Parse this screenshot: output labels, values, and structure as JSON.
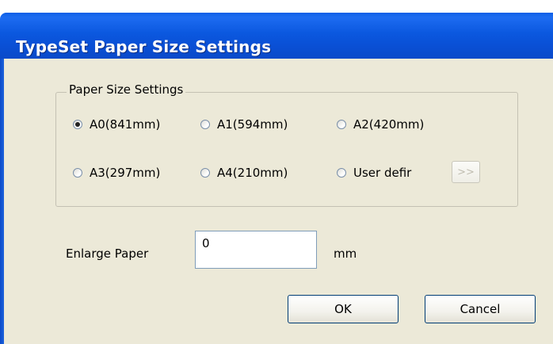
{
  "window": {
    "title": "TypeSet Paper Size Settings"
  },
  "paper_size": {
    "group_label": "Paper Size Settings",
    "options": [
      {
        "label": "A0(841mm)",
        "checked": true
      },
      {
        "label": "A1(594mm)",
        "checked": false
      },
      {
        "label": "A2(420mm)",
        "checked": false
      },
      {
        "label": "A3(297mm)",
        "checked": false
      },
      {
        "label": "A4(210mm)",
        "checked": false
      },
      {
        "label": "User defir",
        "checked": false
      }
    ],
    "more_button_label": ">>"
  },
  "enlarge": {
    "label": "Enlarge Paper",
    "value": "0",
    "unit": "mm"
  },
  "buttons": {
    "ok": "OK",
    "cancel": "Cancel"
  },
  "colors": {
    "titlebar": "#0b58df",
    "dialog_background": "#ece9d8",
    "button_border": "#003c74"
  }
}
